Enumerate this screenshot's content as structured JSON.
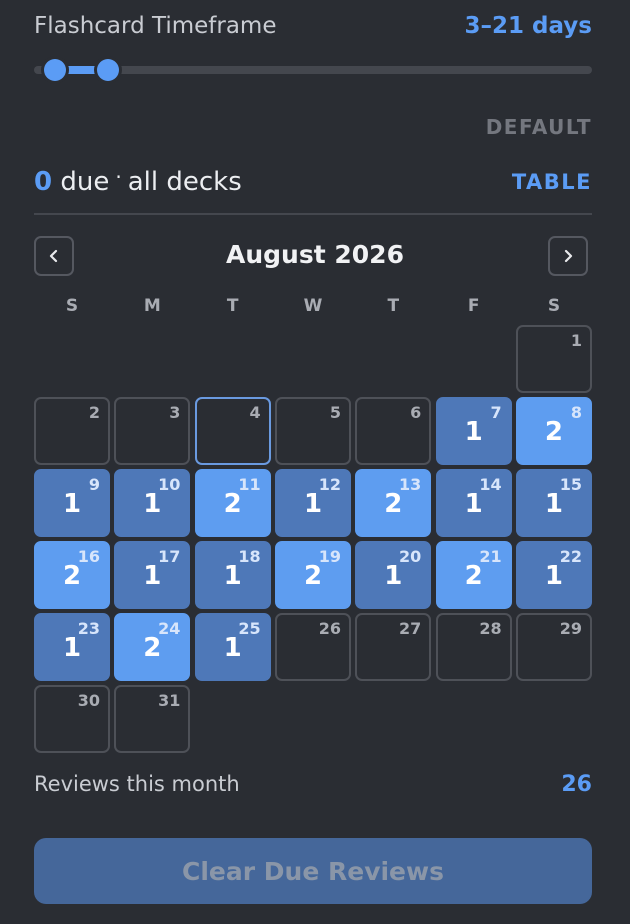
{
  "timeframe": {
    "label": "Flashcard Timeframe",
    "value": "3–21 days",
    "range_start_fraction": 0.038,
    "range_end_fraction": 0.132
  },
  "default_label": "DEFAULT",
  "due": {
    "count": "0",
    "suffix": "due",
    "separator": "·",
    "scope": "all decks",
    "table_label": "TABLE"
  },
  "calendar": {
    "month_title": "August 2026",
    "weekdays": [
      "S",
      "M",
      "T",
      "W",
      "T",
      "F",
      "S"
    ],
    "first_weekday_index": 6,
    "today": 4,
    "days": [
      {
        "day": "1",
        "count": ""
      },
      {
        "day": "2",
        "count": ""
      },
      {
        "day": "3",
        "count": ""
      },
      {
        "day": "4",
        "count": ""
      },
      {
        "day": "5",
        "count": ""
      },
      {
        "day": "6",
        "count": ""
      },
      {
        "day": "7",
        "count": "1"
      },
      {
        "day": "8",
        "count": "2"
      },
      {
        "day": "9",
        "count": "1"
      },
      {
        "day": "10",
        "count": "1"
      },
      {
        "day": "11",
        "count": "2"
      },
      {
        "day": "12",
        "count": "1"
      },
      {
        "day": "13",
        "count": "2"
      },
      {
        "day": "14",
        "count": "1"
      },
      {
        "day": "15",
        "count": "1"
      },
      {
        "day": "16",
        "count": "2"
      },
      {
        "day": "17",
        "count": "1"
      },
      {
        "day": "18",
        "count": "1"
      },
      {
        "day": "19",
        "count": "2"
      },
      {
        "day": "20",
        "count": "1"
      },
      {
        "day": "21",
        "count": "2"
      },
      {
        "day": "22",
        "count": "1"
      },
      {
        "day": "23",
        "count": "1"
      },
      {
        "day": "24",
        "count": "2"
      },
      {
        "day": "25",
        "count": "1"
      },
      {
        "day": "26",
        "count": ""
      },
      {
        "day": "27",
        "count": ""
      },
      {
        "day": "28",
        "count": ""
      },
      {
        "day": "29",
        "count": ""
      },
      {
        "day": "30",
        "count": ""
      },
      {
        "day": "31",
        "count": ""
      }
    ]
  },
  "reviews": {
    "label": "Reviews this month",
    "value": "26"
  },
  "clear_button_label": "Clear Due Reviews",
  "colors": {
    "accent": "#5b9cf5",
    "level_1": "#4e78b8",
    "level_2": "#5e9df0",
    "background": "#2a2d33"
  }
}
